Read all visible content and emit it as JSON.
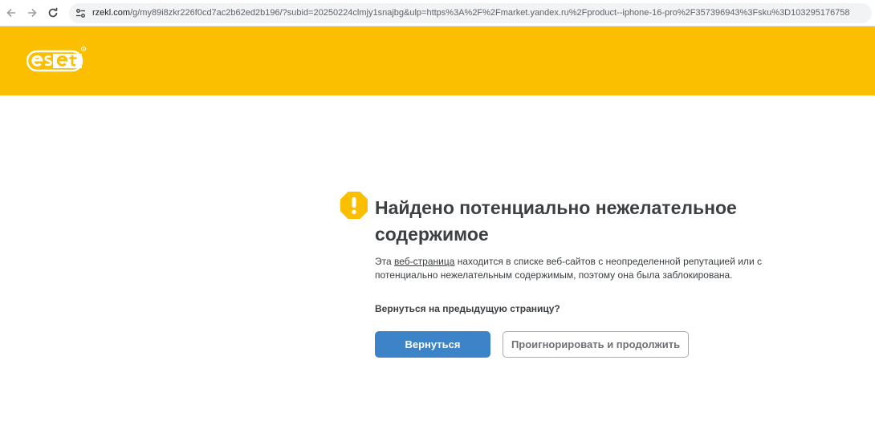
{
  "browser": {
    "url_host": "rzekl.com",
    "url_rest": "/g/my89i8zkr226f0cd7ac2b62ed2b196/?subid=20250224clmjy1snajbg&ulp=https%3A%2F%2Fmarket.yandex.ru%2Fproduct--iphone-16-pro%2F357396943%3Fsku%3D103295176758",
    "icons": [
      "back-arrow-icon",
      "forward-arrow-icon",
      "reload-icon",
      "site-info-icon"
    ]
  },
  "header": {
    "logo_text": "eset",
    "brand_color": "#fbbf00"
  },
  "warning": {
    "icon": "warning-icon",
    "title": "Найдено потенциально нежелательное содержимое",
    "description_before": "Эта ",
    "description_link": "веб-страница",
    "description_after": " находится в списке веб-сайтов с неопределенной репутацией или с потенциально нежелательным содержимым, поэтому она была заблокирована.",
    "question": "Вернуться на предыдущую страницу?",
    "back_button": "Вернуться",
    "ignore_button": "Проигнорировать и продолжить",
    "accent_color": "#3c83c7",
    "warning_color": "#fbbf00"
  }
}
